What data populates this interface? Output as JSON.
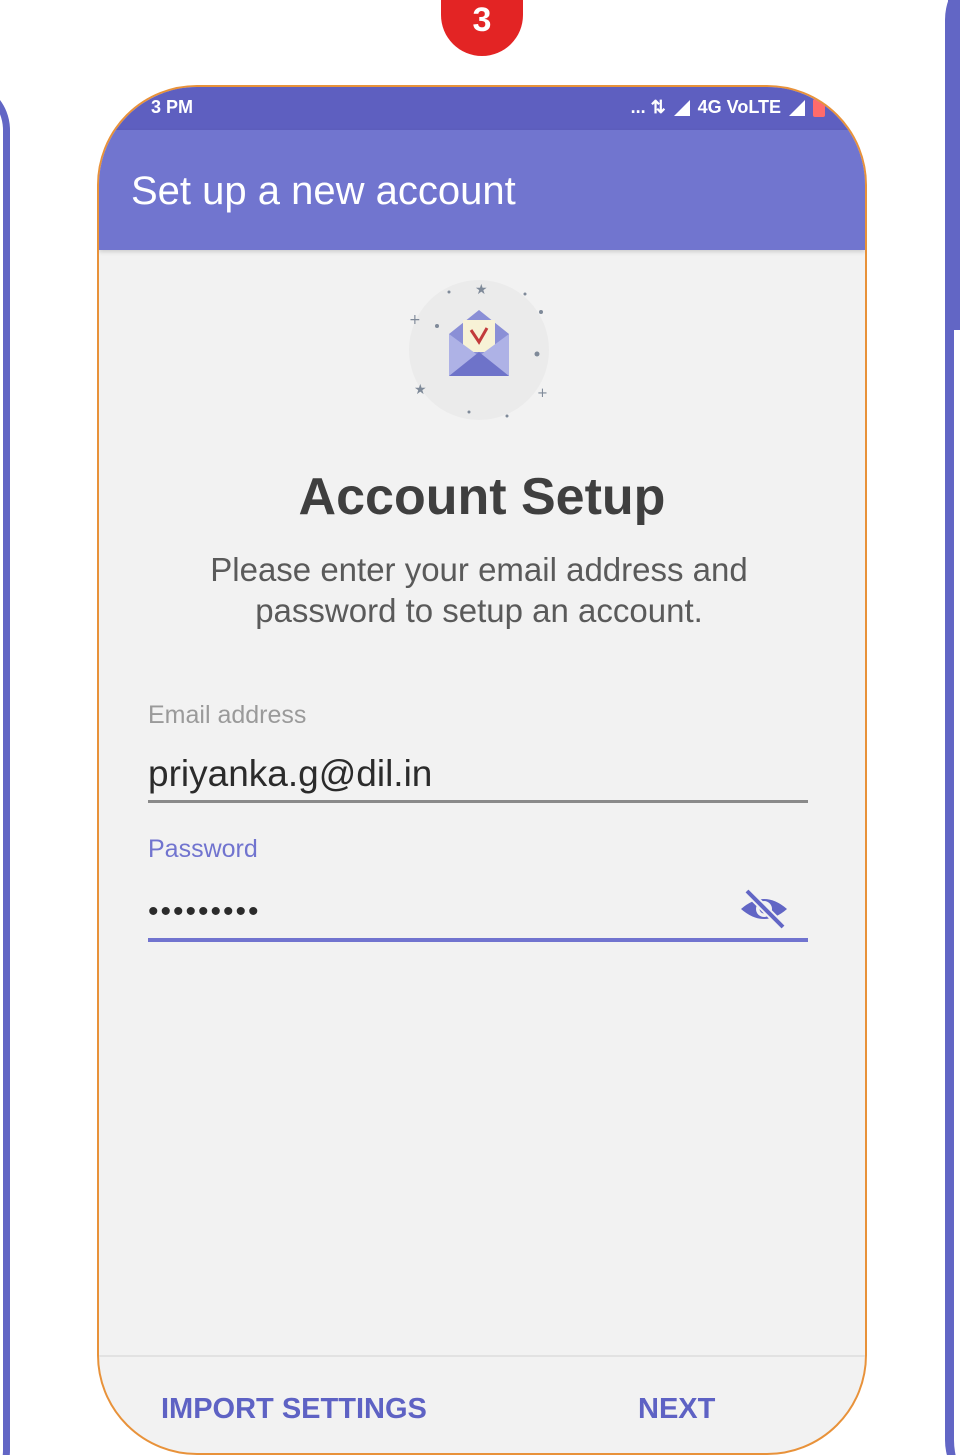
{
  "step": {
    "number": "3",
    "color": "#e32424"
  },
  "status_bar": {
    "time": "3 PM",
    "network": "... ⇅",
    "network_type": "4G VoLTE"
  },
  "app_bar": {
    "title": "Set up a new account",
    "color": "#7175cf"
  },
  "illustration": {
    "icon": "envelope-letter-icon"
  },
  "setup": {
    "title": "Account Setup",
    "description": "Please enter your email address and password to setup an account."
  },
  "email_field": {
    "label": "Email address",
    "value": "priyanka.g@dil.in"
  },
  "password_field": {
    "label": "Password",
    "value": "•••••••••",
    "toggle_icon": "visibility-off-icon"
  },
  "footer": {
    "import_label": "IMPORT SETTINGS",
    "next_label": "NEXT",
    "button_color": "#5e62c4"
  }
}
